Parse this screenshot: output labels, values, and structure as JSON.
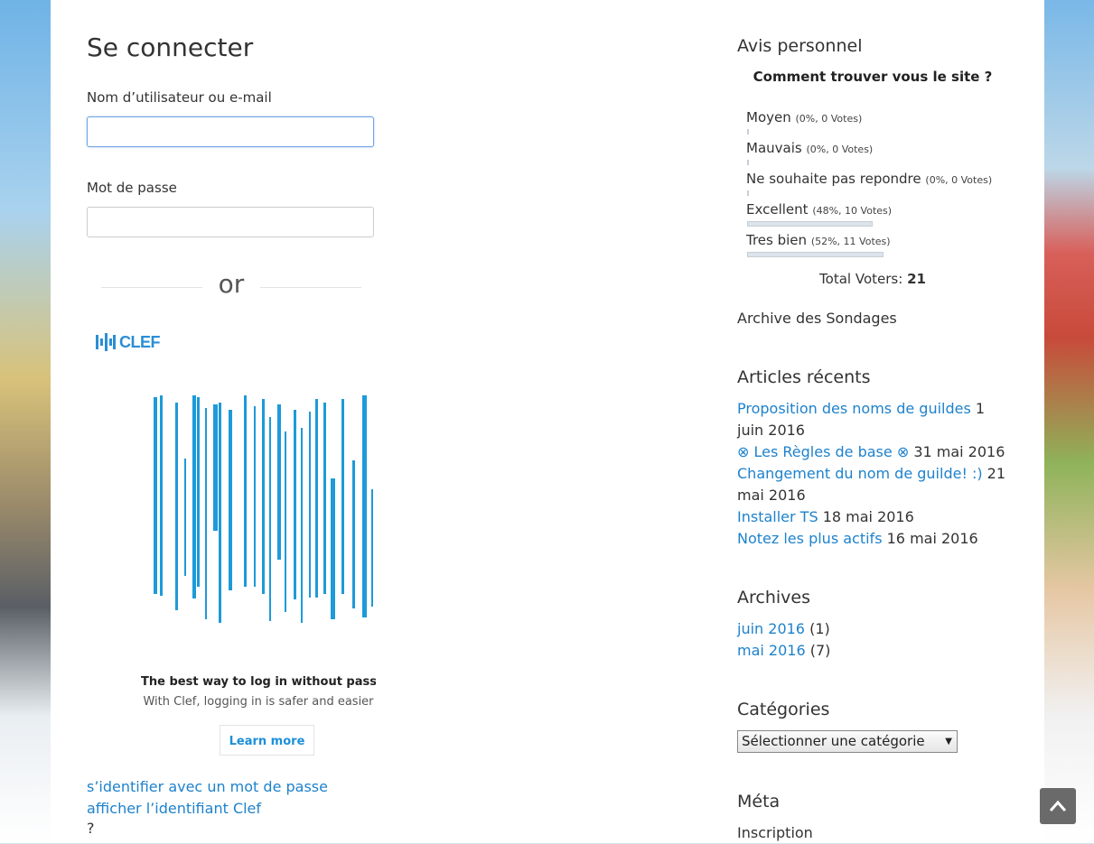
{
  "login": {
    "title": "Se connecter",
    "username_label": "Nom d’utilisateur ou e-mail",
    "username_value": "",
    "password_label": "Mot de passe",
    "password_value": "",
    "or_text": "or"
  },
  "clef": {
    "logo_text": "CLEF",
    "headline": "The best way to log in without passwor",
    "subtext": "With Clef, logging in is safer and easier",
    "learn_more": "Learn more"
  },
  "alt_login": {
    "link_text": "s’identifier avec un mot de passe afficher l’identifiant Clef",
    "question_mark": "?"
  },
  "sidebar": {
    "poll": {
      "widget_title": "Avis personnel",
      "question": "Comment trouver vous le site ?",
      "options": [
        {
          "label": "Moyen",
          "stats": "(0%, 0 Votes)",
          "percent": 0
        },
        {
          "label": "Mauvais",
          "stats": "(0%, 0 Votes)",
          "percent": 0
        },
        {
          "label": "Ne souhaite pas repondre",
          "stats": "(0%, 0 Votes)",
          "percent": 0
        },
        {
          "label": "Excellent",
          "stats": "(48%, 10 Votes)",
          "percent": 48
        },
        {
          "label": "Tres bien",
          "stats": "(52%, 11 Votes)",
          "percent": 52
        }
      ],
      "total_label": "Total Voters:",
      "total_value": "21",
      "archive_link": "Archive des Sondages"
    },
    "recent": {
      "title": "Articles récents",
      "items": [
        {
          "title": "Proposition des noms de guildes",
          "date": "1 juin 2016"
        },
        {
          "title": "⊗ Les Règles de base ⊗",
          "date": "31 mai 2016"
        },
        {
          "title": "Changement du nom de guilde! :)",
          "date": "21 mai 2016"
        },
        {
          "title": "Installer TS",
          "date": "18 mai 2016"
        },
        {
          "title": "Notez les plus actifs",
          "date": "16 mai 2016"
        }
      ]
    },
    "archives": {
      "title": "Archives",
      "items": [
        {
          "label": "juin 2016",
          "count": "(1)"
        },
        {
          "label": "mai 2016",
          "count": "(7)"
        }
      ]
    },
    "categories": {
      "title": "Catégories",
      "selected": "Sélectionner une catégorie"
    },
    "meta": {
      "title": "Méta",
      "items": [
        "Inscription"
      ]
    }
  },
  "colors": {
    "link": "#1e82cc",
    "clef_blue": "#1d9ad9",
    "focus_border": "#6ea4e4"
  },
  "icons": {
    "scroll_top": "chevron-up-icon",
    "clef_logo": "clef-bars-icon"
  }
}
